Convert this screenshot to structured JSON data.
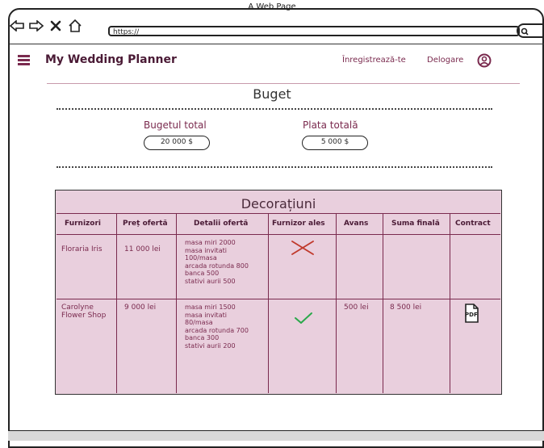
{
  "window": {
    "title": "A Web Page",
    "url": "https://"
  },
  "header": {
    "brand": "My Wedding Planner",
    "register": "Înregistrează-te",
    "logout": "Delogare"
  },
  "budget": {
    "title": "Buget",
    "total_label": "Bugetul total",
    "total_value": "20 000 $",
    "paid_label": "Plata totală",
    "paid_value": "5 000 $"
  },
  "decorations": {
    "title": "Decorațiuni",
    "columns": [
      "Furnizori",
      "Preț ofertă",
      "Detalii ofertă",
      "Furnizor ales",
      "Avans",
      "Suma finală",
      "Contract"
    ],
    "rows": [
      {
        "supplier": "Floraria Iris",
        "price": "11 000 lei",
        "details": [
          "masa miri 2000",
          "masa invitati",
          "100/masa",
          "arcada rotunda 800",
          "banca 500",
          "stativi aurii 500"
        ],
        "chosen": "no",
        "advance": "",
        "final": "",
        "contract": ""
      },
      {
        "supplier": "Carolyne Flower Shop",
        "price": "9 000 lei",
        "details": [
          "masa miri 1500",
          "masa invitati",
          "80/masa",
          "arcada rotunda 700",
          "banca 300",
          "stativi aurii 200"
        ],
        "chosen": "yes",
        "advance": "500 lei",
        "final": "8 500 lei",
        "contract": "PDF"
      }
    ]
  },
  "colors": {
    "accent": "#7a2a4e",
    "panel": "#e9cfdd",
    "check": "#2aa84a",
    "cross": "#c0392b"
  },
  "icons": [
    "back-icon",
    "forward-icon",
    "close-icon",
    "home-icon",
    "search-icon",
    "menu-icon",
    "user-icon",
    "cross-icon",
    "check-icon",
    "pdf-icon"
  ]
}
